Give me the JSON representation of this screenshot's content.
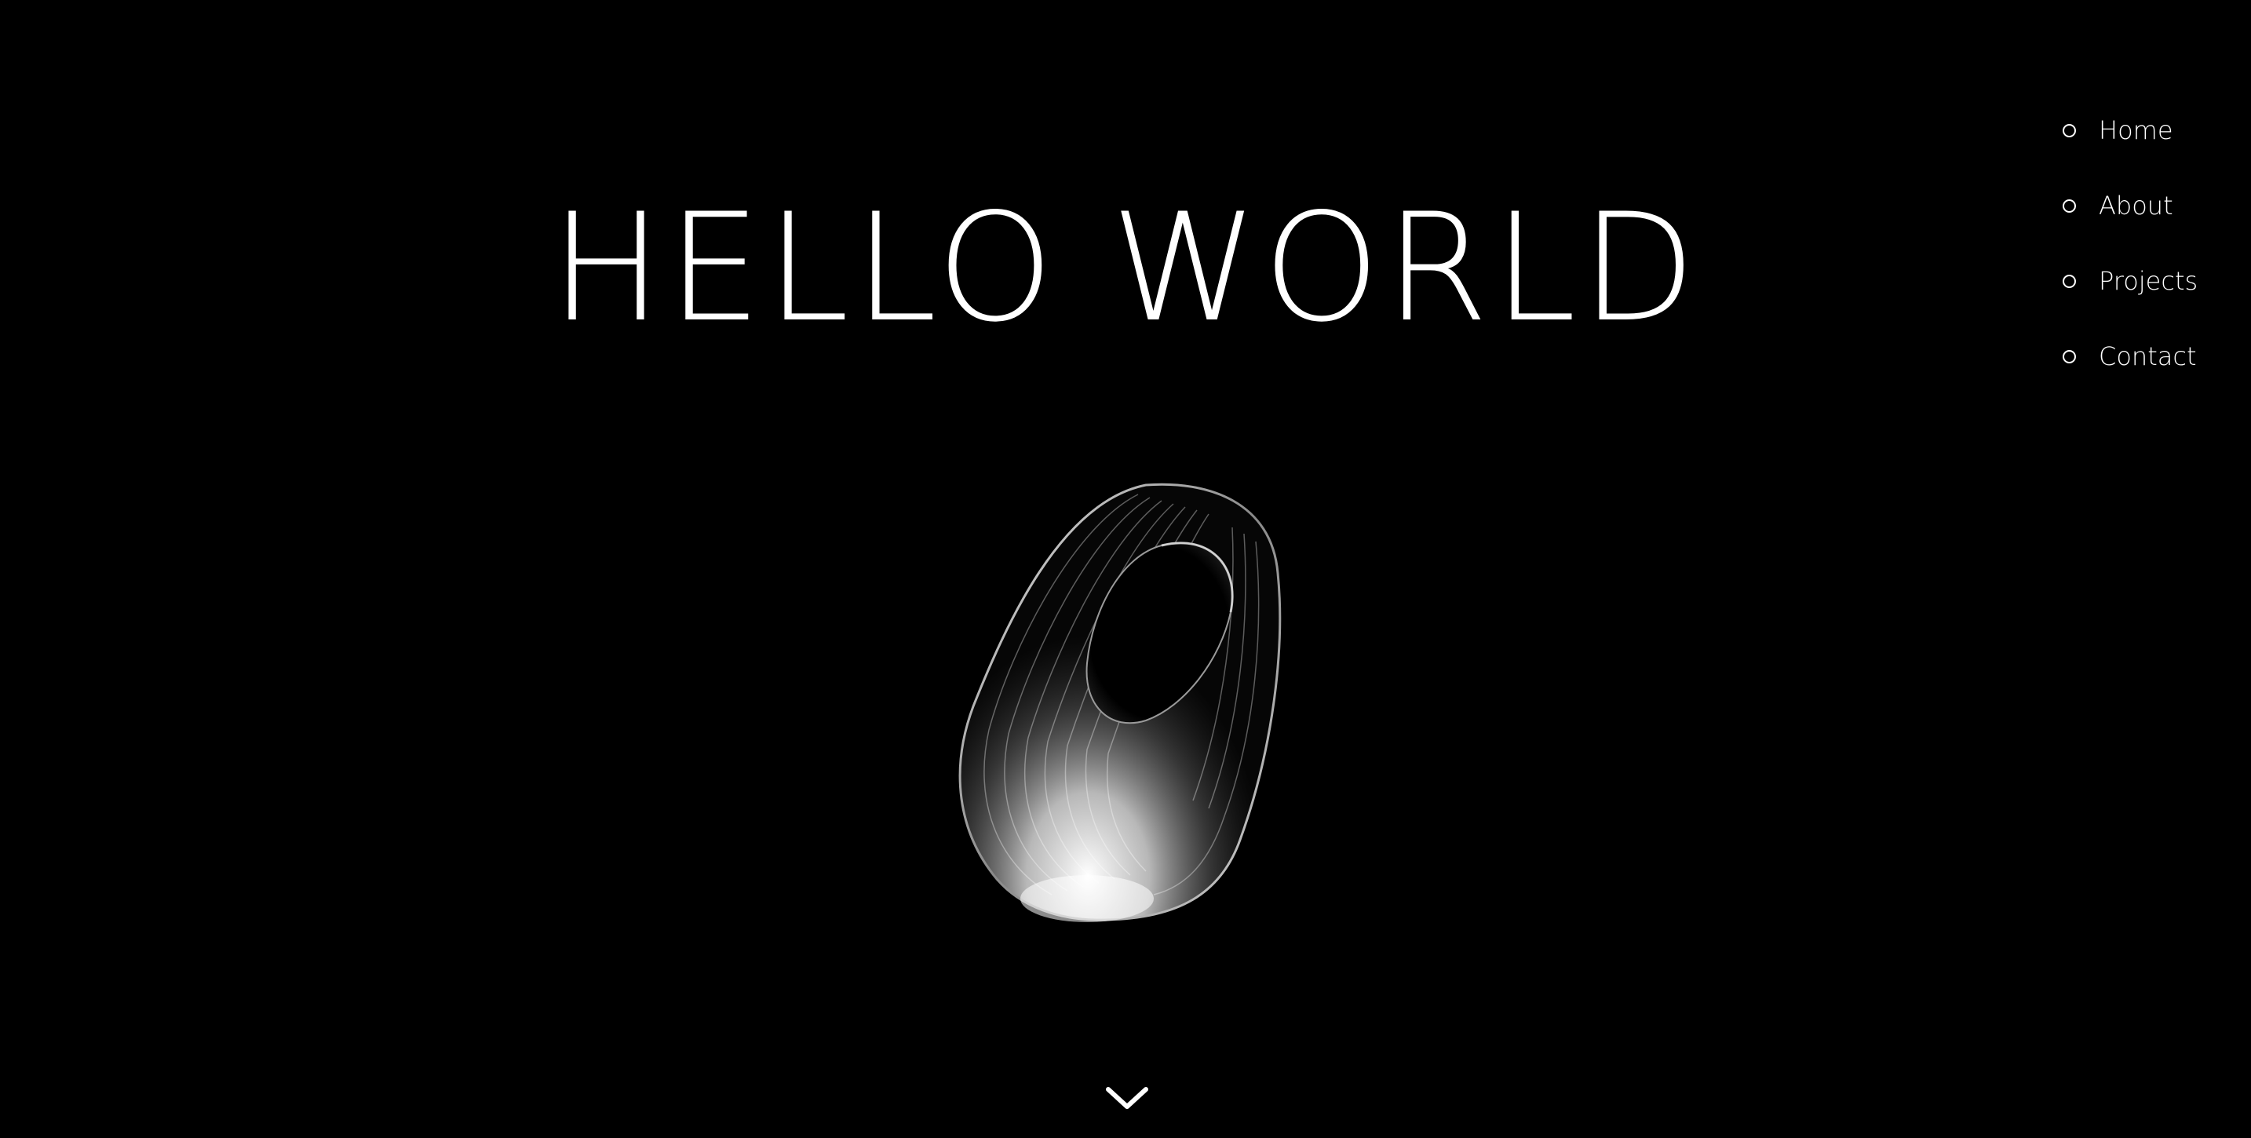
{
  "hero": {
    "title": "HELLO WORLD"
  },
  "nav": {
    "items": [
      {
        "label": "Home"
      },
      {
        "label": "About"
      },
      {
        "label": "Projects"
      },
      {
        "label": "Contact"
      }
    ]
  },
  "icons": {
    "nav_marker": "circle-outline-icon",
    "scroll": "chevron-down-icon"
  },
  "colors": {
    "background": "#000000",
    "foreground": "#ffffff"
  }
}
